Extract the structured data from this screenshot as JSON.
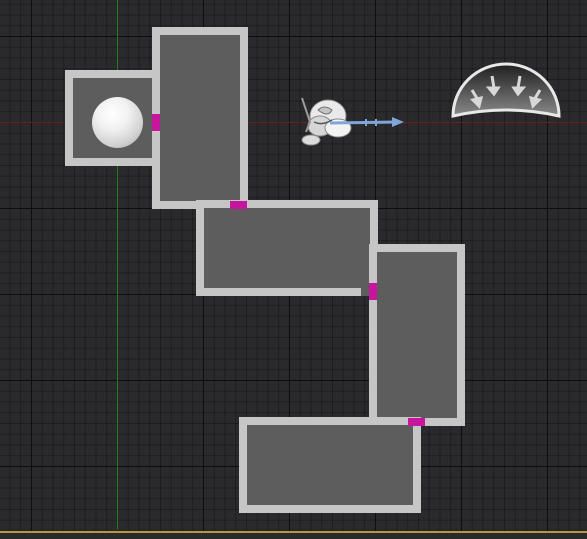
{
  "scene": {
    "viewport_label": "",
    "grid": true,
    "colors": {
      "background": "#2a2a2d",
      "room_fill": "#5d5d5d",
      "room_wall": "#c6c6c6",
      "door": "#c8159e",
      "axis_x": "#6a1e1e",
      "axis_y": "#1f7a1f",
      "arrow": "#7fa6d6",
      "bottom_bar_accent": "#b79a3a"
    },
    "rooms": [
      {
        "name": "room-small-left"
      },
      {
        "name": "room-tall-top"
      },
      {
        "name": "room-wide-middle"
      },
      {
        "name": "room-tall-right"
      },
      {
        "name": "room-wide-bottom"
      }
    ],
    "doors": [
      {
        "name": "door-1"
      },
      {
        "name": "door-2"
      },
      {
        "name": "door-3"
      },
      {
        "name": "door-4"
      }
    ],
    "objects": {
      "sphere": {
        "icon": "sphere-icon"
      },
      "character": {
        "icon": "character-gizmo-icon",
        "arrow_icon": "direction-arrow-icon"
      },
      "light": {
        "icon": "area-light-icon"
      }
    }
  }
}
